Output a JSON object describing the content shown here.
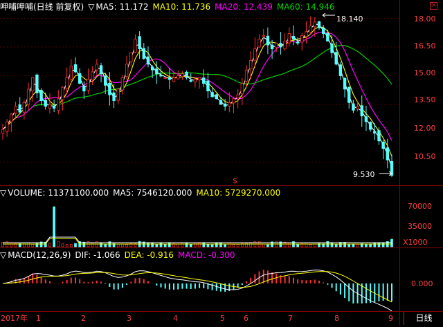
{
  "price_header": {
    "stock_name": "呷哺呷哺(日线 前复权)",
    "ma5": "MA5: 11.172",
    "ma10": "MA10: 11.736",
    "ma20": "MA20: 12.439",
    "ma60": "MA60: 14.946"
  },
  "volume_header": {
    "volume": "VOLUME: 11371100.000",
    "ma5": "MA5: 7546120.000",
    "ma10": "MA10: 5729270.000"
  },
  "macd_header": {
    "label": "MACD(12,26,9)",
    "dif": "DIF: -1.066",
    "dea": "DEA: -0.916",
    "macd": "MACD: -0.300"
  },
  "price_axis": {
    "ticks": [
      "18.00",
      "16.50",
      "15.00",
      "13.50",
      "12.00",
      "10.50"
    ]
  },
  "volume_axis": {
    "ticks": [
      "70000",
      "35000"
    ],
    "unit": "X1000"
  },
  "macd_axis": {
    "ticks": [
      "0.000"
    ]
  },
  "date_axis": {
    "labels": [
      "2017年",
      "1",
      "2",
      "3",
      "4",
      "5",
      "6",
      "7",
      "8",
      "9"
    ]
  },
  "annotations": {
    "high": "18.140",
    "low": "9.530",
    "marker": "$"
  },
  "period_tab": "日线",
  "colors": {
    "up": "#ff3030",
    "down": "#55ffff",
    "ma5": "#ffffff",
    "ma10": "#ffff00",
    "ma20": "#ff00ff",
    "ma60": "#00d000",
    "grid": "#8b0000",
    "axis_text": "#ff4040"
  },
  "chart_data": {
    "type": "candlestick",
    "price_range": [
      9.5,
      18.3
    ],
    "price_ticks": [
      18.0,
      16.5,
      15.0,
      13.5,
      12.0,
      10.5
    ],
    "high_marker": 18.14,
    "low_marker": 9.53,
    "close_path": [
      12.2,
      12.6,
      13.0,
      13.4,
      13.1,
      13.6,
      14.3,
      14.9,
      14.1,
      13.7,
      13.4,
      13.5,
      13.3,
      13.8,
      14.4,
      14.9,
      15.5,
      15.2,
      14.6,
      14.2,
      14.8,
      15.2,
      15.6,
      15.1,
      14.5,
      14.0,
      13.7,
      14.3,
      14.9,
      15.6,
      16.2,
      16.9,
      16.4,
      15.9,
      15.6,
      15.3,
      15.1,
      15.0,
      14.9,
      14.8,
      14.9,
      15.0,
      15.1,
      14.9,
      14.7,
      14.8,
      14.9,
      14.6,
      14.2,
      13.9,
      13.8,
      13.5,
      13.4,
      13.6,
      13.8,
      14.0,
      14.6,
      15.3,
      15.8,
      16.4,
      16.9,
      17.1,
      16.6,
      16.4,
      16.7,
      16.5,
      16.8,
      17.2,
      16.9,
      16.7,
      17.1,
      17.3,
      17.6,
      17.8,
      17.5,
      17.2,
      16.8,
      16.2,
      15.6,
      15.0,
      14.3,
      13.6,
      13.2,
      13.4,
      12.9,
      12.6,
      12.2,
      12.0,
      11.6,
      11.2,
      10.6,
      9.8
    ]
  }
}
